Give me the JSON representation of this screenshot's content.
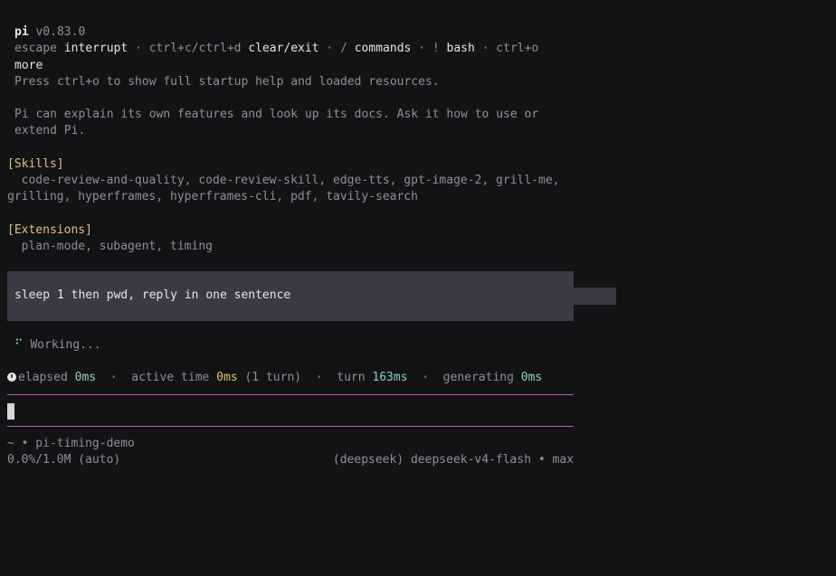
{
  "header": {
    "app_name": "pi",
    "version": "v0.83.0",
    "keys": [
      {
        "key": "escape",
        "action": "interrupt"
      },
      {
        "key": "ctrl+c/ctrl+d",
        "action": "clear/exit"
      },
      {
        "key": "/",
        "action": "commands"
      },
      {
        "key": "!",
        "action": "bash"
      },
      {
        "key": "ctrl+o",
        "action": "more"
      }
    ],
    "separator": "·",
    "help_line": "Press ctrl+o to show full startup help and loaded resources.",
    "info_line1": "Pi can explain its own features and look up its docs. Ask it how to use or",
    "info_line2": "extend Pi."
  },
  "skills": {
    "title": "[Skills]",
    "line1": "  code-review-and-quality, code-review-skill, edge-tts, gpt-image-2, grill-me,",
    "line2": "grilling, hyperframes, hyperframes-cli, pdf, tavily-search"
  },
  "extensions": {
    "title": "[Extensions]",
    "line1": "  plan-mode, subagent, timing"
  },
  "prompt": {
    "text": "sleep 1 then pwd, reply in one sentence"
  },
  "status": {
    "spinner": "⠋",
    "working": "Working..."
  },
  "timing": {
    "elapsed_label": "elapsed",
    "elapsed_value": "0ms",
    "active_label": "active time",
    "active_value": "0ms",
    "active_suffix": "(1 turn)",
    "turn_label": "turn",
    "turn_value": "163ms",
    "generating_label": "generating",
    "generating_value": "0ms",
    "sep": "·"
  },
  "footer": {
    "path": "~ • pi-timing-demo",
    "context": "0.0%/1.0M (auto)",
    "model": "(deepseek) deepseek-v4-flash • max"
  }
}
